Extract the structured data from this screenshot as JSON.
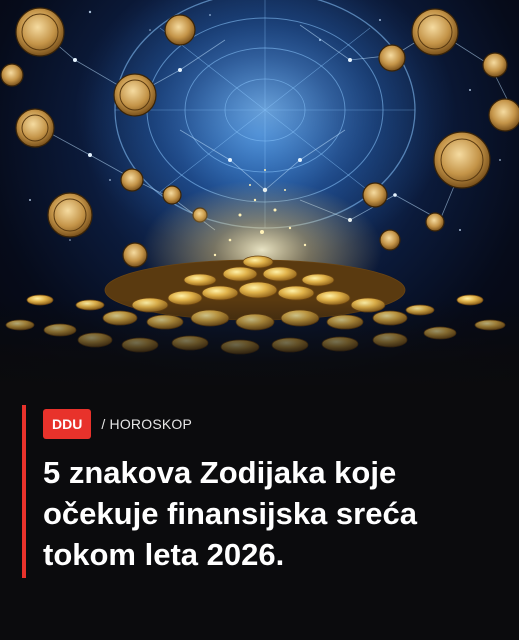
{
  "article": {
    "image_alt": "Zodiac constellation wheel above a pile of gold coins",
    "source_badge": "DDU",
    "category": "/ HOROSKOP",
    "headline": "5 znakova Zodijaka koje očekuje finansijska sreća tokom leta 2026."
  },
  "colors": {
    "accent": "#e8322b",
    "background": "#0b0b0d",
    "headline_text": "#ffffff"
  }
}
